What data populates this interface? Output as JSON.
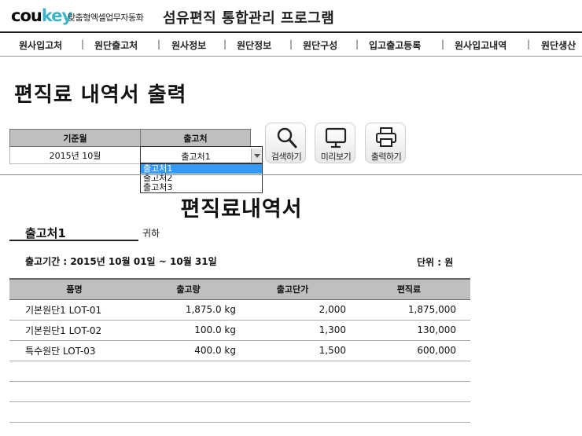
{
  "header": {
    "logo_part1": "cou",
    "logo_part2": "key",
    "tagline": "맞춤형엑셀업무자동화",
    "app_title": "섬유편직 통합관리 프로그램"
  },
  "menu": [
    "원사입고처",
    "원단출고처",
    "원사정보",
    "원단정보",
    "원단구성",
    "입고출고등록",
    "원사입고내역",
    "원단생산"
  ],
  "menu_separator": "|",
  "page_title": "편직료 내역서 출력",
  "filter": {
    "period_header": "기준월",
    "period_value": "2015년 10월",
    "customer_header": "출고처",
    "customer_value": "출고처1",
    "options": [
      "출고처1",
      "출고처2",
      "출고처3"
    ]
  },
  "buttons": {
    "search": "검색하기",
    "preview": "미리보기",
    "print": "출력하기"
  },
  "document": {
    "title": "편직료내역서",
    "recipient": "출고처1",
    "honorific": "귀하",
    "period": "출고기간 : 2015년 10월 01일 ~ 10월 31일",
    "unit": "단위 : 원"
  },
  "table": {
    "headers": [
      "품명",
      "출고량",
      "출고단가",
      "편직료"
    ],
    "rows": [
      [
        "기본원단1 LOT-01",
        "1,875.0 kg",
        "2,000",
        "1,875,000"
      ],
      [
        "기본원단1 LOT-02",
        "100.0 kg",
        "1,300",
        "130,000"
      ],
      [
        "특수원단 LOT-03",
        "400.0 kg",
        "1,500",
        "600,000"
      ]
    ]
  },
  "colors": {
    "logo_accent": "#3cb4c8",
    "header_gray": "#bfbfbf",
    "selection_blue": "#3399ff"
  }
}
